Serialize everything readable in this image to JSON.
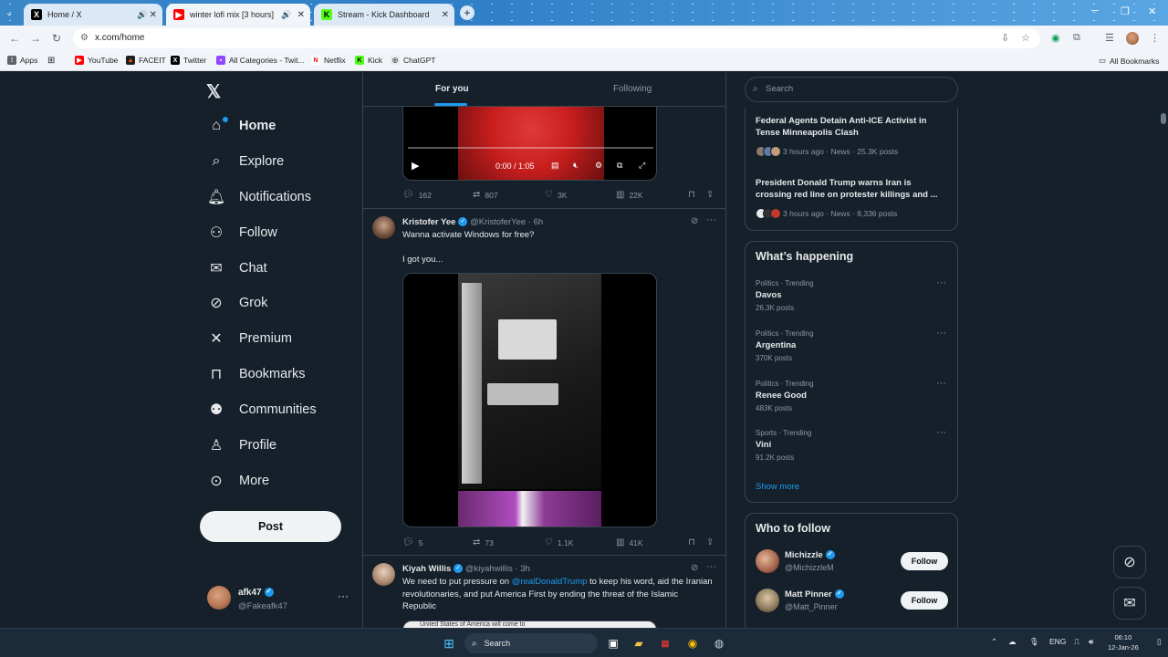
{
  "browser": {
    "tabs": [
      {
        "title": "Home / X",
        "active": false
      },
      {
        "title": "winter lofi mix [3 hours] ",
        "active": true
      },
      {
        "title": "Stream - Kick Dashboard",
        "active": false
      }
    ],
    "url": "x.com/home",
    "bookmarks": [
      "Apps",
      "YouTube",
      "FACEIT",
      "Twitter",
      "All Categories - Twit...",
      "Netflix",
      "Kick",
      "ChatGPT"
    ],
    "all_bookmarks": "All Bookmarks"
  },
  "nav": {
    "items": [
      {
        "label": "Home",
        "icon": "home-icon"
      },
      {
        "label": "Explore",
        "icon": "search-icon"
      },
      {
        "label": "Notifications",
        "icon": "bell-icon"
      },
      {
        "label": "Follow",
        "icon": "person-add-icon"
      },
      {
        "label": "Chat",
        "icon": "mail-icon"
      },
      {
        "label": "Grok",
        "icon": "grok-icon"
      },
      {
        "label": "Premium",
        "icon": "x-logo-icon"
      },
      {
        "label": "Bookmarks",
        "icon": "bookmark-icon"
      },
      {
        "label": "Communities",
        "icon": "communities-icon"
      },
      {
        "label": "Profile",
        "icon": "person-icon"
      },
      {
        "label": "More",
        "icon": "more-circle-icon"
      }
    ],
    "post_label": "Post"
  },
  "account": {
    "name": "afk47",
    "handle": "@Fakeafk47"
  },
  "feed": {
    "tab_for_you": "For you",
    "tab_following": "Following",
    "video": {
      "time": "0:00 / 1:05"
    },
    "tweet0_stats": {
      "replies": "162",
      "reposts": "807",
      "likes": "3K",
      "views": "22K"
    },
    "tweet1": {
      "name": "Kristofer Yee",
      "handle": "@KristoferYee",
      "time": "· 6h",
      "line1": "Wanna activate Windows for free?",
      "line2": "I got you...",
      "stats": {
        "replies": "5",
        "reposts": "73",
        "likes": "1.1K",
        "views": "41K"
      }
    },
    "tweet2": {
      "name": "Kiyah Willis",
      "handle": "@kiyahwillis",
      "time": "· 3h",
      "text_before": "We need to put pressure on ",
      "mention": "@realDonaldTrump",
      "text_after": " to keep his word, aid the Iranian revolutionaries, and put America First by ending the threat of the Islamic Republic",
      "image_caption": "United States of America will come to"
    }
  },
  "right": {
    "search_placeholder": "Search",
    "news": [
      {
        "title": "Federal Agents Detain Anti-ICE Activist in Tense Minneapolis Clash",
        "meta": "3 hours ago · News · 25.3K posts"
      },
      {
        "title": "President Donald Trump warns Iran is crossing red line on protester killings and ...",
        "meta": "3 hours ago · News · 8,336 posts"
      }
    ],
    "happening_title": "What’s happening",
    "trends": [
      {
        "category": "Politics · Trending",
        "name": "Davos",
        "count": "26.3K posts"
      },
      {
        "category": "Politics · Trending",
        "name": "Argentina",
        "count": "370K posts"
      },
      {
        "category": "Politics · Trending",
        "name": "Renee Good",
        "count": "483K posts"
      },
      {
        "category": "Sports · Trending",
        "name": "Vini",
        "count": "91.2K posts"
      }
    ],
    "show_more": "Show more",
    "wtf_title": "Who to follow",
    "wtf": [
      {
        "name": "Michizzle",
        "handle": "@MichizzleM",
        "button": "Follow"
      },
      {
        "name": "Matt Pinner",
        "handle": "@Matt_Pinner",
        "button": "Follow"
      }
    ]
  },
  "taskbar": {
    "search": "Search",
    "lang": "ENG",
    "time": "06:10",
    "date": "12-Jan-26"
  },
  "colors": {
    "accent": "#1d9bf0",
    "background": "#15202b",
    "border": "#38444d"
  }
}
